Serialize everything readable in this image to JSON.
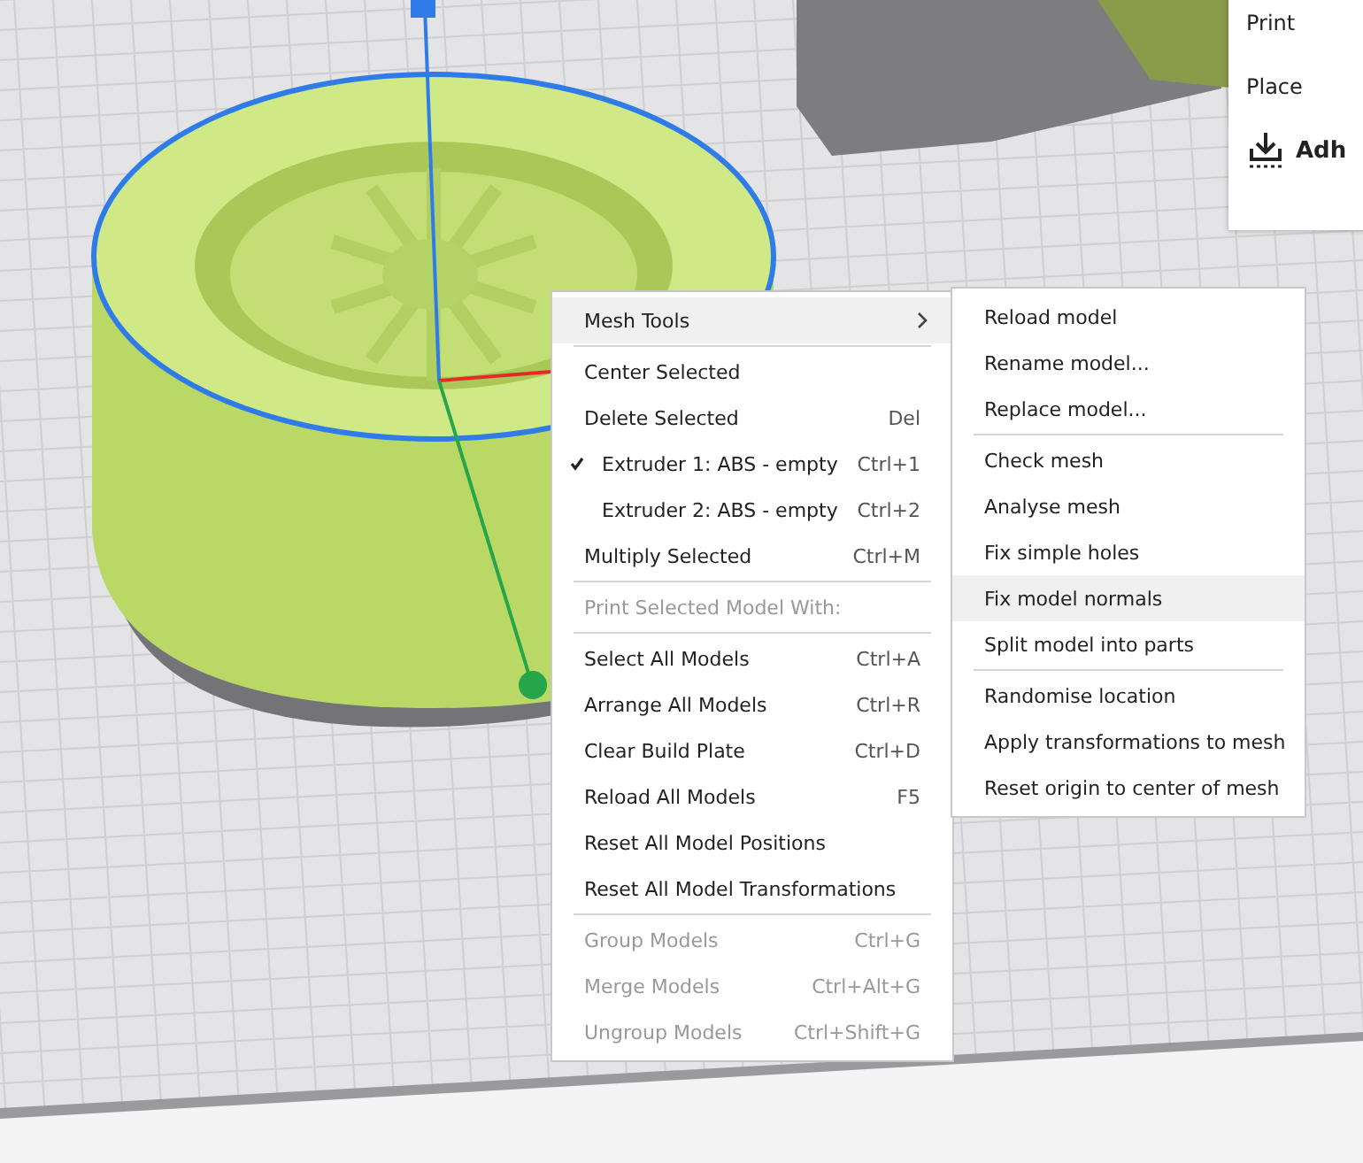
{
  "settings_panel": {
    "rows": [
      "Print",
      "Place"
    ],
    "section": "Adh"
  },
  "context_menu": {
    "items": [
      {
        "kind": "submenu",
        "label": "Mesh Tools",
        "selected": true,
        "disabled": false
      },
      {
        "kind": "separator"
      },
      {
        "kind": "item",
        "label": "Center Selected",
        "selected": false,
        "disabled": false
      },
      {
        "kind": "item",
        "label": "Delete Selected",
        "shortcut": "Del",
        "selected": false,
        "disabled": false
      },
      {
        "kind": "check",
        "label": "Extruder 1: ABS - empty",
        "shortcut": "Ctrl+1",
        "checked": true,
        "selected": false,
        "disabled": false
      },
      {
        "kind": "check",
        "label": "Extruder 2: ABS - empty",
        "shortcut": "Ctrl+2",
        "checked": false,
        "selected": false,
        "disabled": false
      },
      {
        "kind": "item",
        "label": "Multiply Selected",
        "shortcut": "Ctrl+M",
        "selected": false,
        "disabled": false
      },
      {
        "kind": "separator"
      },
      {
        "kind": "item",
        "label": "Print Selected Model With:",
        "selected": false,
        "disabled": true
      },
      {
        "kind": "separator"
      },
      {
        "kind": "item",
        "label": "Select All Models",
        "shortcut": "Ctrl+A",
        "selected": false,
        "disabled": false
      },
      {
        "kind": "item",
        "label": "Arrange All Models",
        "shortcut": "Ctrl+R",
        "selected": false,
        "disabled": false
      },
      {
        "kind": "item",
        "label": "Clear Build Plate",
        "shortcut": "Ctrl+D",
        "selected": false,
        "disabled": false
      },
      {
        "kind": "item",
        "label": "Reload All Models",
        "shortcut": "F5",
        "selected": false,
        "disabled": false
      },
      {
        "kind": "item",
        "label": "Reset All Model Positions",
        "selected": false,
        "disabled": false
      },
      {
        "kind": "item",
        "label": "Reset All Model Transformations",
        "selected": false,
        "disabled": false
      },
      {
        "kind": "separator"
      },
      {
        "kind": "item",
        "label": "Group Models",
        "shortcut": "Ctrl+G",
        "selected": false,
        "disabled": true
      },
      {
        "kind": "item",
        "label": "Merge Models",
        "shortcut": "Ctrl+Alt+G",
        "selected": false,
        "disabled": true
      },
      {
        "kind": "item",
        "label": "Ungroup Models",
        "shortcut": "Ctrl+Shift+G",
        "selected": false,
        "disabled": true
      }
    ]
  },
  "submenu": {
    "items": [
      {
        "kind": "item",
        "label": "Reload model",
        "selected": false
      },
      {
        "kind": "item",
        "label": "Rename model...",
        "selected": false
      },
      {
        "kind": "item",
        "label": "Replace model...",
        "selected": false
      },
      {
        "kind": "separator"
      },
      {
        "kind": "item",
        "label": "Check mesh",
        "selected": false
      },
      {
        "kind": "item",
        "label": "Analyse mesh",
        "selected": false
      },
      {
        "kind": "item",
        "label": "Fix simple holes",
        "selected": false
      },
      {
        "kind": "item",
        "label": "Fix model normals",
        "selected": true
      },
      {
        "kind": "item",
        "label": "Split model into parts",
        "selected": false
      },
      {
        "kind": "separator"
      },
      {
        "kind": "item",
        "label": "Randomise location",
        "selected": false
      },
      {
        "kind": "item",
        "label": "Apply transformations to mesh",
        "selected": false
      },
      {
        "kind": "item",
        "label": "Reset origin to center of mesh",
        "selected": false
      }
    ]
  }
}
